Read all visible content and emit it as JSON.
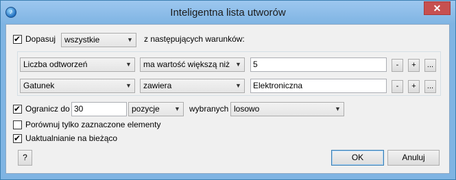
{
  "window": {
    "title": "Inteligentna lista utworów",
    "close_glyph": "✕",
    "icon": "itunes-icon"
  },
  "match": {
    "checked": true,
    "label": "Dopasuj",
    "scope_value": "wszystkie",
    "suffix": "z następujących warunków:"
  },
  "rules": [
    {
      "field": "Liczba odtworzeń",
      "operator": "ma wartość większą niż",
      "value": "5"
    },
    {
      "field": "Gatunek",
      "operator": "zawiera",
      "value": "Elektroniczna"
    }
  ],
  "rule_buttons": {
    "remove": "-",
    "add": "+",
    "more": "..."
  },
  "limit": {
    "checked": true,
    "label": "Ogranicz do",
    "amount": "30",
    "unit": "pozycje",
    "selected_by_label": "wybranych",
    "order": "losowo"
  },
  "checked_only": {
    "checked": false,
    "label": "Porównuj tylko zaznaczone elementy"
  },
  "live_update": {
    "checked": true,
    "label": "Uaktualnianie na bieżąco"
  },
  "buttons": {
    "help": "?",
    "ok": "OK",
    "cancel": "Anuluj"
  },
  "icons": {
    "dropdown": "chevron-down-icon",
    "check": "checkmark-icon"
  }
}
